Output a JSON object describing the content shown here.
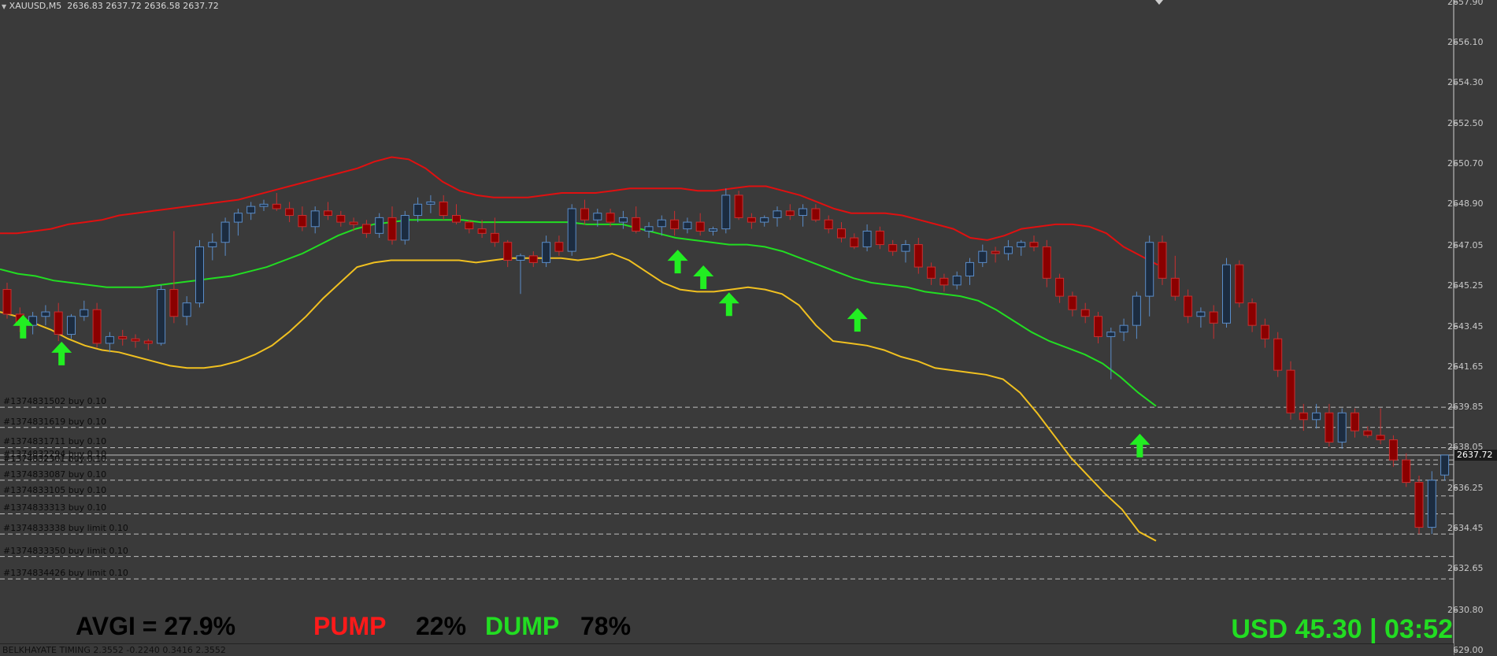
{
  "header": {
    "symbol": "XAUUSD,M5",
    "ohlc": "2636.83 2637.72 2636.58 2637.72"
  },
  "y_axis": [
    "2657.90",
    "2656.10",
    "2654.30",
    "2652.50",
    "2650.70",
    "2648.90",
    "2647.05",
    "2645.25",
    "2643.45",
    "2641.65",
    "2639.85",
    "2638.05",
    "2636.25",
    "2634.45",
    "2632.65",
    "2630.80",
    "2629.00"
  ],
  "current_price": "2637.72",
  "orders": [
    "#1374831502 buy 0.10",
    "#1374831619 buy 0.10",
    "#1374831711 buy 0.10",
    "#1374832294 buy 0.10",
    "#1374832301 buy 0.10",
    "#1374833087 buy 0.10",
    "#1374833105 buy 0.10",
    "#1374833313 buy 0.10",
    "#1374833338 buy limit 0.10",
    "#1374833350 buy limit 0.10",
    "#1374834426 buy limit 0.10"
  ],
  "stats": {
    "avgi": "AVGI = 27.9%",
    "pump_label": "PUMP",
    "pump_value": "22%",
    "dump_label": "DUMP",
    "dump_value": "78%"
  },
  "account": "USD 45.30 | 03:52",
  "indicator": "BELKHAYATE TIMING 2.3552 -0.2240 0.3416 2.3552",
  "colors": {
    "background": "#3a3a3a",
    "bull": "#1c2c40",
    "bear": "#8b0000",
    "upper_band": "#e01010",
    "mid_band": "#22dd22",
    "lower_band": "#f0c020",
    "arrow": "#22ee22",
    "avgi_text": "#000000",
    "pump_text": "#ff1a1a",
    "dump_text": "#22dd22"
  },
  "chart_data": {
    "type": "candlestick",
    "title": "XAUUSD,M5",
    "y_range": [
      2628.8,
      2658.0
    ],
    "candles": [
      [
        2645.1,
        2645.4,
        2643.8,
        2644.0
      ],
      [
        2644.0,
        2644.3,
        2643.2,
        2643.5
      ],
      [
        2643.5,
        2644.1,
        2643.1,
        2643.9
      ],
      [
        2643.9,
        2644.4,
        2643.5,
        2644.1
      ],
      [
        2644.1,
        2644.5,
        2642.8,
        2643.1
      ],
      [
        2643.1,
        2644.0,
        2642.9,
        2643.9
      ],
      [
        2643.9,
        2644.6,
        2643.7,
        2644.2
      ],
      [
        2644.2,
        2644.5,
        2642.5,
        2642.7
      ],
      [
        2642.7,
        2643.2,
        2642.3,
        2643.0
      ],
      [
        2643.0,
        2643.3,
        2642.6,
        2642.9
      ],
      [
        2642.9,
        2643.1,
        2642.5,
        2642.8
      ],
      [
        2642.8,
        2642.9,
        2642.4,
        2642.7
      ],
      [
        2642.7,
        2645.3,
        2642.6,
        2645.1
      ],
      [
        2645.1,
        2647.7,
        2643.6,
        2643.9
      ],
      [
        2643.9,
        2644.8,
        2643.5,
        2644.5
      ],
      [
        2644.5,
        2647.3,
        2644.3,
        2647.0
      ],
      [
        2647.0,
        2647.6,
        2646.4,
        2647.2
      ],
      [
        2647.2,
        2648.3,
        2646.6,
        2648.1
      ],
      [
        2648.1,
        2648.7,
        2647.5,
        2648.5
      ],
      [
        2648.5,
        2649.0,
        2648.2,
        2648.8
      ],
      [
        2648.8,
        2649.1,
        2648.6,
        2648.9
      ],
      [
        2648.9,
        2649.4,
        2648.6,
        2648.7
      ],
      [
        2648.7,
        2649.0,
        2648.1,
        2648.4
      ],
      [
        2648.4,
        2648.8,
        2647.7,
        2647.9
      ],
      [
        2647.9,
        2648.8,
        2647.6,
        2648.6
      ],
      [
        2648.6,
        2649.0,
        2648.2,
        2648.4
      ],
      [
        2648.4,
        2648.6,
        2647.9,
        2648.1
      ],
      [
        2648.1,
        2648.3,
        2647.7,
        2648.0
      ],
      [
        2648.0,
        2648.2,
        2647.4,
        2647.6
      ],
      [
        2647.6,
        2648.5,
        2647.4,
        2648.3
      ],
      [
        2648.3,
        2648.8,
        2647.1,
        2647.3
      ],
      [
        2647.3,
        2648.6,
        2647.1,
        2648.4
      ],
      [
        2648.4,
        2649.2,
        2648.1,
        2648.9
      ],
      [
        2648.9,
        2649.3,
        2648.5,
        2649.0
      ],
      [
        2649.0,
        2649.3,
        2648.2,
        2648.4
      ],
      [
        2648.4,
        2648.9,
        2648.0,
        2648.1
      ],
      [
        2648.1,
        2648.2,
        2647.6,
        2647.8
      ],
      [
        2647.8,
        2648.2,
        2647.4,
        2647.6
      ],
      [
        2647.6,
        2648.3,
        2647.0,
        2647.2
      ],
      [
        2647.2,
        2647.3,
        2646.1,
        2646.4
      ],
      [
        2646.4,
        2646.7,
        2644.9,
        2646.6
      ],
      [
        2646.6,
        2646.8,
        2646.1,
        2646.3
      ],
      [
        2646.3,
        2647.5,
        2646.1,
        2647.2
      ],
      [
        2647.2,
        2647.5,
        2646.6,
        2646.8
      ],
      [
        2646.8,
        2648.9,
        2646.6,
        2648.7
      ],
      [
        2648.7,
        2649.1,
        2648.0,
        2648.2
      ],
      [
        2648.2,
        2648.7,
        2647.9,
        2648.5
      ],
      [
        2648.5,
        2648.7,
        2647.9,
        2648.1
      ],
      [
        2648.1,
        2648.6,
        2647.8,
        2648.3
      ],
      [
        2648.3,
        2648.8,
        2647.6,
        2647.7
      ],
      [
        2647.7,
        2648.1,
        2647.4,
        2647.9
      ],
      [
        2647.9,
        2648.4,
        2647.5,
        2648.2
      ],
      [
        2648.2,
        2648.6,
        2647.5,
        2647.8
      ],
      [
        2647.8,
        2648.3,
        2647.6,
        2648.1
      ],
      [
        2648.1,
        2648.5,
        2647.5,
        2647.7
      ],
      [
        2647.7,
        2647.9,
        2647.5,
        2647.8
      ],
      [
        2647.8,
        2649.6,
        2647.6,
        2649.3
      ],
      [
        2649.3,
        2649.5,
        2648.2,
        2648.3
      ],
      [
        2648.3,
        2648.5,
        2647.8,
        2648.1
      ],
      [
        2648.1,
        2648.4,
        2647.9,
        2648.3
      ],
      [
        2648.3,
        2648.8,
        2647.9,
        2648.6
      ],
      [
        2648.6,
        2648.9,
        2648.2,
        2648.4
      ],
      [
        2648.4,
        2648.9,
        2647.9,
        2648.7
      ],
      [
        2648.7,
        2648.9,
        2648.1,
        2648.2
      ],
      [
        2648.2,
        2648.4,
        2647.6,
        2647.8
      ],
      [
        2647.8,
        2648.1,
        2647.2,
        2647.4
      ],
      [
        2647.4,
        2647.6,
        2646.9,
        2647.0
      ],
      [
        2647.0,
        2648.0,
        2646.8,
        2647.7
      ],
      [
        2647.7,
        2647.9,
        2646.9,
        2647.1
      ],
      [
        2647.1,
        2647.3,
        2646.6,
        2646.8
      ],
      [
        2646.8,
        2647.3,
        2646.3,
        2647.1
      ],
      [
        2647.1,
        2647.4,
        2645.8,
        2646.1
      ],
      [
        2646.1,
        2646.3,
        2645.3,
        2645.6
      ],
      [
        2645.6,
        2645.8,
        2645.0,
        2645.3
      ],
      [
        2645.3,
        2645.9,
        2645.1,
        2645.7
      ],
      [
        2645.7,
        2646.5,
        2645.3,
        2646.3
      ],
      [
        2646.3,
        2647.1,
        2646.1,
        2646.8
      ],
      [
        2646.8,
        2647.0,
        2646.3,
        2646.7
      ],
      [
        2646.7,
        2647.3,
        2646.4,
        2647.0
      ],
      [
        2647.0,
        2647.3,
        2646.6,
        2647.2
      ],
      [
        2647.2,
        2647.5,
        2646.8,
        2647.0
      ],
      [
        2647.0,
        2647.3,
        2645.2,
        2645.6
      ],
      [
        2645.6,
        2645.8,
        2644.5,
        2644.8
      ],
      [
        2644.8,
        2645.0,
        2643.9,
        2644.2
      ],
      [
        2644.2,
        2644.5,
        2643.6,
        2643.9
      ],
      [
        2643.9,
        2644.1,
        2642.7,
        2643.0
      ],
      [
        2643.0,
        2643.4,
        2641.1,
        2643.2
      ],
      [
        2643.2,
        2643.8,
        2642.8,
        2643.5
      ],
      [
        2643.5,
        2645.0,
        2642.9,
        2644.8
      ],
      [
        2644.8,
        2647.5,
        2643.9,
        2647.2
      ],
      [
        2647.2,
        2647.5,
        2645.3,
        2645.6
      ],
      [
        2645.6,
        2646.6,
        2644.6,
        2644.8
      ],
      [
        2644.8,
        2645.1,
        2643.6,
        2643.9
      ],
      [
        2643.9,
        2644.3,
        2643.4,
        2644.1
      ],
      [
        2644.1,
        2644.4,
        2642.9,
        2643.6
      ],
      [
        2643.6,
        2646.5,
        2643.4,
        2646.2
      ],
      [
        2646.2,
        2646.4,
        2644.3,
        2644.5
      ],
      [
        2644.5,
        2644.7,
        2643.2,
        2643.5
      ],
      [
        2643.5,
        2643.8,
        2642.5,
        2642.9
      ],
      [
        2642.9,
        2643.2,
        2641.2,
        2641.5
      ],
      [
        2641.5,
        2641.9,
        2639.3,
        2639.6
      ],
      [
        2639.6,
        2640.0,
        2638.8,
        2639.3
      ],
      [
        2639.3,
        2640.0,
        2638.9,
        2639.6
      ],
      [
        2639.6,
        2640.0,
        2638.1,
        2638.3
      ],
      [
        2638.3,
        2639.8,
        2638.0,
        2639.6
      ],
      [
        2639.6,
        2639.8,
        2638.5,
        2638.8
      ],
      [
        2638.8,
        2639.0,
        2638.5,
        2638.6
      ],
      [
        2638.6,
        2639.8,
        2638.2,
        2638.4
      ],
      [
        2638.4,
        2638.6,
        2637.2,
        2637.5
      ],
      [
        2637.5,
        2637.8,
        2636.3,
        2636.5
      ],
      [
        2636.5,
        2636.8,
        2634.2,
        2634.5
      ],
      [
        2634.5,
        2637.0,
        2634.2,
        2636.6
      ],
      [
        2636.83,
        2637.72,
        2636.58,
        2637.72
      ]
    ],
    "upper_band": [
      2647.6,
      2647.6,
      2647.7,
      2647.8,
      2648.0,
      2648.1,
      2648.2,
      2648.4,
      2648.5,
      2648.6,
      2648.7,
      2648.8,
      2648.9,
      2649.0,
      2649.1,
      2649.3,
      2649.5,
      2649.7,
      2649.9,
      2650.1,
      2650.3,
      2650.5,
      2650.8,
      2651.0,
      2650.9,
      2650.5,
      2649.9,
      2649.5,
      2649.3,
      2649.2,
      2649.2,
      2649.2,
      2649.3,
      2649.4,
      2649.4,
      2649.4,
      2649.5,
      2649.6,
      2649.6,
      2649.6,
      2649.6,
      2649.5,
      2649.5,
      2649.6,
      2649.7,
      2649.7,
      2649.5,
      2649.3,
      2649.0,
      2648.7,
      2648.5,
      2648.5,
      2648.5,
      2648.4,
      2648.2,
      2648.0,
      2647.8,
      2647.4,
      2647.3,
      2647.5,
      2647.8,
      2647.9,
      2648.0,
      2648.0,
      2647.9,
      2647.6,
      2647.0,
      2646.6,
      2646.2
    ],
    "middle_band": [
      2646.0,
      2645.8,
      2645.7,
      2645.5,
      2645.4,
      2645.3,
      2645.2,
      2645.2,
      2645.2,
      2645.3,
      2645.4,
      2645.5,
      2645.6,
      2645.7,
      2645.9,
      2646.1,
      2646.4,
      2646.7,
      2647.1,
      2647.5,
      2647.8,
      2648.0,
      2648.1,
      2648.2,
      2648.2,
      2648.2,
      2648.2,
      2648.1,
      2648.1,
      2648.1,
      2648.1,
      2648.1,
      2648.1,
      2648.0,
      2648.0,
      2648.0,
      2647.8,
      2647.6,
      2647.4,
      2647.3,
      2647.2,
      2647.1,
      2647.1,
      2647.0,
      2646.8,
      2646.5,
      2646.2,
      2645.9,
      2645.6,
      2645.4,
      2645.3,
      2645.2,
      2645.0,
      2644.9,
      2644.8,
      2644.6,
      2644.2,
      2643.7,
      2643.2,
      2642.8,
      2642.5,
      2642.2,
      2641.8,
      2641.2,
      2640.5,
      2639.9
    ],
    "lower_band": [
      2644.1,
      2643.9,
      2643.6,
      2643.3,
      2642.9,
      2642.6,
      2642.4,
      2642.3,
      2642.1,
      2641.9,
      2641.7,
      2641.6,
      2641.6,
      2641.7,
      2641.9,
      2642.2,
      2642.6,
      2643.2,
      2643.9,
      2644.7,
      2645.4,
      2646.1,
      2646.3,
      2646.4,
      2646.4,
      2646.4,
      2646.4,
      2646.4,
      2646.3,
      2646.4,
      2646.5,
      2646.5,
      2646.5,
      2646.5,
      2646.4,
      2646.5,
      2646.7,
      2646.4,
      2645.9,
      2645.4,
      2645.1,
      2645.0,
      2645.0,
      2645.1,
      2645.2,
      2645.1,
      2644.9,
      2644.4,
      2643.5,
      2642.8,
      2642.7,
      2642.6,
      2642.4,
      2642.1,
      2641.9,
      2641.6,
      2641.5,
      2641.4,
      2641.3,
      2641.1,
      2640.5,
      2639.6,
      2638.6,
      2637.6,
      2636.8,
      2636.0,
      2635.3,
      2634.3,
      2633.9
    ],
    "signals_up": [
      [
        1,
        2643.2
      ],
      [
        4,
        2642.0
      ],
      [
        52,
        2646.1
      ],
      [
        54,
        2645.4
      ],
      [
        56,
        2644.2
      ],
      [
        66,
        2643.5
      ],
      [
        88,
        2637.9
      ]
    ],
    "order_prices": [
      2639.85,
      2638.95,
      2638.05,
      2637.5,
      2637.3,
      2636.6,
      2635.9,
      2635.1,
      2634.2,
      2633.2,
      2632.2
    ]
  }
}
